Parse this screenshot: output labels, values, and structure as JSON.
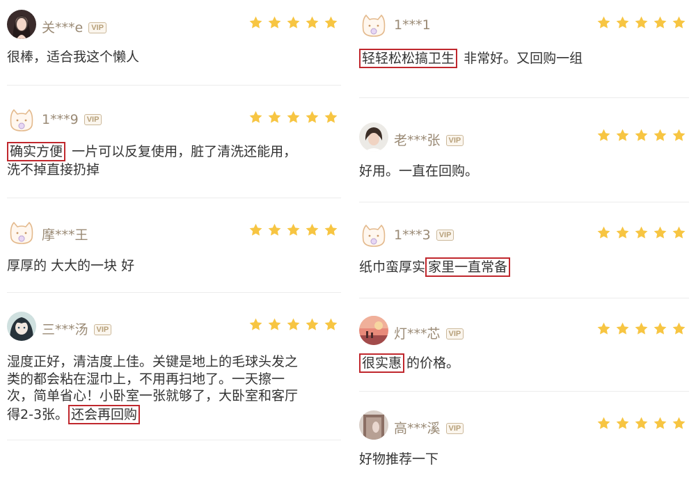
{
  "left": [
    {
      "user": "关***e",
      "vip": true,
      "rating": 5,
      "avatar": "avatar-woman-icon",
      "highlight": "",
      "text": "很棒，适合我这个懒人",
      "text2": ""
    },
    {
      "user": "1***9",
      "vip": true,
      "rating": 5,
      "avatar": "cat-avatar-icon",
      "highlight": "确实方便",
      "text": "一片可以反复使用，脏了清洗还能用，",
      "text2": "洗不掉直接扔掉"
    },
    {
      "user": "摩***王",
      "vip": false,
      "rating": 5,
      "avatar": "cat-avatar-icon",
      "highlight": "",
      "text": "厚厚的 大大的一块 好",
      "text2": ""
    },
    {
      "user": "三***汤",
      "vip": true,
      "rating": 5,
      "avatar": "anime-avatar-icon",
      "highlight": "",
      "text": "湿度正好，清洁度上佳。关键是地上的毛球头发之",
      "line2": "类的都会粘在湿巾上，不用再扫地了。一天擦一",
      "line3": "次，简单省心！小卧室一张就够了，大卧室和客厅",
      "line4": "得2-3张。",
      "tail_highlight": "还会再回购"
    }
  ],
  "right": [
    {
      "user": "1***1",
      "vip": false,
      "rating": 5,
      "avatar": "cat-avatar-icon",
      "highlight": "轻轻松松搞卫生",
      "text": "非常好。又回购一组"
    },
    {
      "user": "老***张",
      "vip": true,
      "rating": 5,
      "avatar": "avatar-woman-icon",
      "highlight": "",
      "text": "好用。一直在回购。"
    },
    {
      "user": "1***3",
      "vip": true,
      "rating": 5,
      "avatar": "cat-avatar-icon",
      "highlight": "",
      "text": "纸巾蛮厚实",
      "tail_highlight": "家里一直常备"
    },
    {
      "user": "灯***芯",
      "vip": true,
      "rating": 5,
      "avatar": "sunset-avatar-icon",
      "highlight": "很实惠",
      "text": "的价格。"
    },
    {
      "user": "高***溪",
      "vip": true,
      "rating": 5,
      "avatar": "door-avatar-icon",
      "highlight": "",
      "text": "好物推荐一下"
    }
  ],
  "vip_label": "VIP",
  "colors": {
    "star": "#f7c542",
    "username": "#9a8a75",
    "highlight_border": "#c0272d",
    "text": "#333333"
  }
}
